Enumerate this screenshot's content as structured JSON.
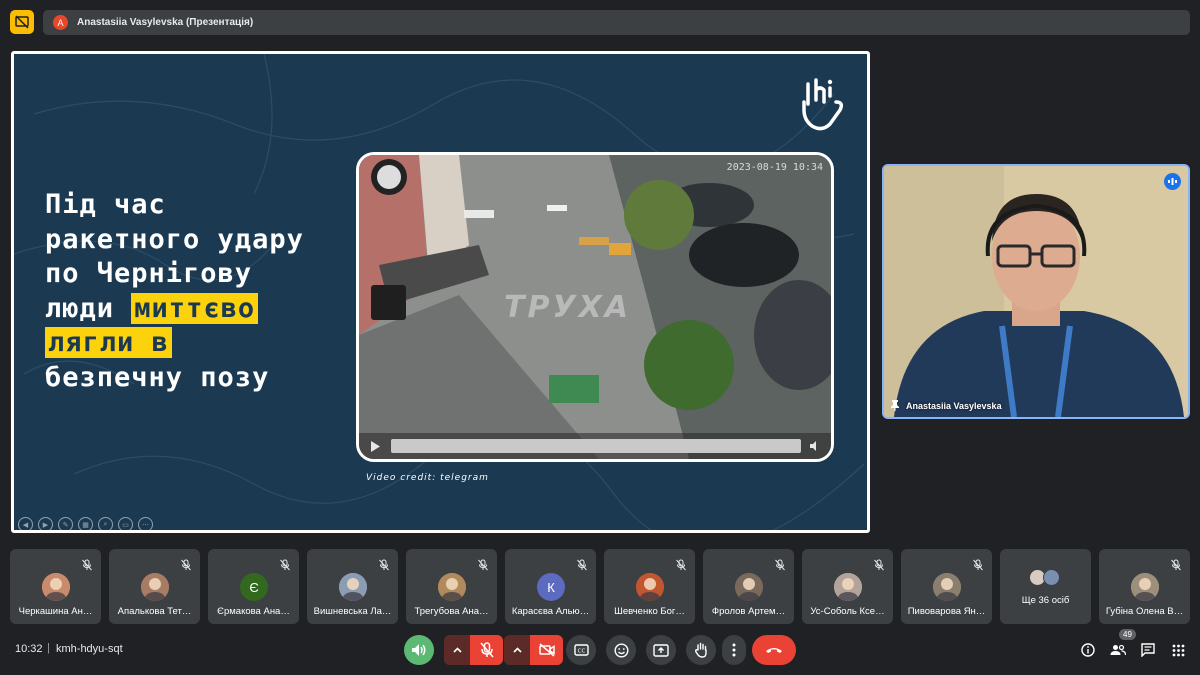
{
  "presenter_bar": {
    "avatar_letter": "A",
    "title": "Anastasiia Vasylevska (Презентація)"
  },
  "slide": {
    "lines": [
      "Під час",
      "ракетного удару",
      "по Чернігову",
      "люди",
      "миттєво",
      "лягли в",
      "безпечну позу"
    ],
    "highlight_color": "#fbd20b",
    "background_color": "#1b3a52",
    "video": {
      "timestamp": "2023-08-19 10:34",
      "watermark": "ТРУХА"
    },
    "credit": "Video credit: telegram"
  },
  "speaker": {
    "name": "Anastasiia Vasylevska"
  },
  "participants": [
    {
      "name": "Черкашина Ан…",
      "avatar": "photo",
      "color": "#c98b6b"
    },
    {
      "name": "Апалькова Тет…",
      "avatar": "photo",
      "color": "#a87b64"
    },
    {
      "name": "Єрмакова Ана…",
      "avatar": "Є",
      "color": "#33691e"
    },
    {
      "name": "Вишневська Ла…",
      "avatar": "photo",
      "color": "#8b9db3"
    },
    {
      "name": "Трегубова Ана…",
      "avatar": "photo",
      "color": "#b08a5b"
    },
    {
      "name": "Карасєва Алью…",
      "avatar": "К",
      "color": "#5c6bc0"
    },
    {
      "name": "Шевченко Бог…",
      "avatar": "photo",
      "color": "#c2562f"
    },
    {
      "name": "Фролов Артем…",
      "avatar": "photo",
      "color": "#7a6a5b"
    },
    {
      "name": "Ус-Соболь Ксе…",
      "avatar": "photo",
      "color": "#b3a49a"
    },
    {
      "name": "Пивоварова Ян…",
      "avatar": "photo",
      "color": "#8a7f6f"
    }
  ],
  "more_tile": {
    "label": "Ще 36 осіб"
  },
  "last_participant": {
    "name": "Губіна Олена В…",
    "avatar": "photo",
    "color": "#9e8f7c"
  },
  "bottom": {
    "time": "10:32",
    "separator": "|",
    "meeting_code": "kmh-hdyu-sqt",
    "participant_count": "49"
  }
}
